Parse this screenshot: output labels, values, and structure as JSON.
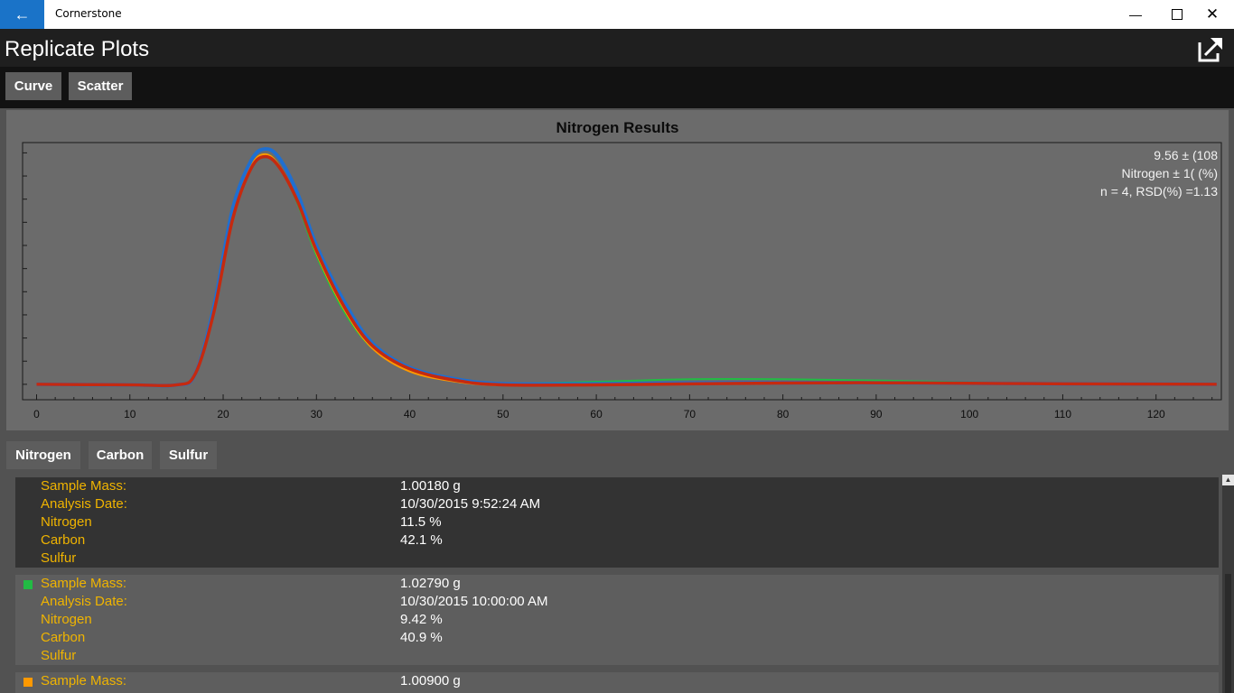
{
  "titlebar": {
    "app_title": "Cornerstone"
  },
  "header": {
    "page_title": "Replicate Plots"
  },
  "plot_tabs": [
    "Curve",
    "Scatter"
  ],
  "element_tabs": [
    "Nitrogen",
    "Carbon",
    "Sulfur"
  ],
  "colors": {
    "accent": "#1a73c8",
    "label": "#f0b400",
    "green": "#22bb44",
    "orange": "#ff9900",
    "blue": "#1f6fd1",
    "red": "#c42a10"
  },
  "chart_data": {
    "type": "line",
    "title": "Nitrogen Results",
    "stats_lines": [
      "9.56  ± (108",
      "Nitrogen ± 1( (%)",
      "n = 4, RSD(%) =1.13"
    ],
    "xlim": [
      -1.5,
      127
    ],
    "ylim": [
      0,
      1
    ],
    "grid": false,
    "x_ticks": [
      0,
      10,
      20,
      30,
      40,
      50,
      60,
      70,
      80,
      90,
      100,
      110,
      120
    ],
    "series": [
      {
        "color": "#22bb44",
        "values": [
          [
            0,
            0.06
          ],
          [
            10,
            0.06
          ],
          [
            15,
            0.06
          ],
          [
            17,
            0.1
          ],
          [
            19,
            0.35
          ],
          [
            21,
            0.72
          ],
          [
            23,
            0.91
          ],
          [
            24.5,
            0.955
          ],
          [
            26,
            0.91
          ],
          [
            28,
            0.76
          ],
          [
            30,
            0.56
          ],
          [
            33,
            0.34
          ],
          [
            36,
            0.2
          ],
          [
            40,
            0.115
          ],
          [
            45,
            0.075
          ],
          [
            50,
            0.062
          ],
          [
            60,
            0.07
          ],
          [
            70,
            0.08
          ],
          [
            80,
            0.08
          ],
          [
            90,
            0.075
          ],
          [
            100,
            0.068
          ],
          [
            110,
            0.064
          ],
          [
            126.5,
            0.062
          ]
        ]
      },
      {
        "color": "#ff9900",
        "values": [
          [
            0,
            0.06
          ],
          [
            10,
            0.058
          ],
          [
            15,
            0.058
          ],
          [
            17,
            0.1
          ],
          [
            19,
            0.35
          ],
          [
            21,
            0.72
          ],
          [
            23,
            0.91
          ],
          [
            24.5,
            0.955
          ],
          [
            26,
            0.91
          ],
          [
            28,
            0.77
          ],
          [
            30,
            0.57
          ],
          [
            33,
            0.35
          ],
          [
            36,
            0.2
          ],
          [
            40,
            0.11
          ],
          [
            45,
            0.07
          ],
          [
            50,
            0.056
          ],
          [
            60,
            0.058
          ],
          [
            70,
            0.062
          ],
          [
            80,
            0.064
          ],
          [
            90,
            0.064
          ],
          [
            100,
            0.062
          ],
          [
            110,
            0.06
          ],
          [
            126.5,
            0.06
          ]
        ]
      },
      {
        "color": "#1f6fd1",
        "values": [
          [
            0,
            0.06
          ],
          [
            10,
            0.058
          ],
          [
            15,
            0.058
          ],
          [
            17,
            0.1
          ],
          [
            19,
            0.36
          ],
          [
            21,
            0.74
          ],
          [
            23,
            0.93
          ],
          [
            24.5,
            0.975
          ],
          [
            26,
            0.94
          ],
          [
            28,
            0.8
          ],
          [
            30,
            0.6
          ],
          [
            33,
            0.38
          ],
          [
            36,
            0.22
          ],
          [
            40,
            0.125
          ],
          [
            45,
            0.08
          ],
          [
            50,
            0.062
          ],
          [
            60,
            0.062
          ],
          [
            70,
            0.065
          ],
          [
            80,
            0.066
          ],
          [
            90,
            0.066
          ],
          [
            100,
            0.064
          ],
          [
            110,
            0.062
          ],
          [
            126.5,
            0.06
          ]
        ]
      },
      {
        "color": "#c42a10",
        "values": [
          [
            0,
            0.06
          ],
          [
            10,
            0.058
          ],
          [
            15,
            0.058
          ],
          [
            17,
            0.1
          ],
          [
            19,
            0.34
          ],
          [
            21,
            0.7
          ],
          [
            23,
            0.9
          ],
          [
            24.5,
            0.945
          ],
          [
            26,
            0.905
          ],
          [
            28,
            0.77
          ],
          [
            30,
            0.58
          ],
          [
            33,
            0.36
          ],
          [
            36,
            0.21
          ],
          [
            40,
            0.12
          ],
          [
            45,
            0.075
          ],
          [
            50,
            0.058
          ],
          [
            60,
            0.058
          ],
          [
            70,
            0.062
          ],
          [
            80,
            0.065
          ],
          [
            90,
            0.066
          ],
          [
            100,
            0.064
          ],
          [
            110,
            0.062
          ],
          [
            126.5,
            0.06
          ]
        ]
      }
    ]
  },
  "results": [
    {
      "swatch": "",
      "rows": [
        {
          "label": "Sample Mass:",
          "value": "1.00180 g"
        },
        {
          "label": "Analysis Date:",
          "value": "10/30/2015 9:52:24 AM"
        },
        {
          "label": "Nitrogen",
          "value": "11.5 %"
        },
        {
          "label": "Carbon",
          "value": "42.1 %"
        },
        {
          "label": "Sulfur",
          "value": ""
        }
      ]
    },
    {
      "swatch": "#22bb44",
      "rows": [
        {
          "label": "Sample Mass:",
          "value": "1.02790 g"
        },
        {
          "label": "Analysis Date:",
          "value": "10/30/2015 10:00:00 AM"
        },
        {
          "label": "Nitrogen",
          "value": "9.42 %"
        },
        {
          "label": "Carbon",
          "value": "40.9 %"
        },
        {
          "label": "Sulfur",
          "value": ""
        }
      ]
    },
    {
      "swatch": "#ff9900",
      "rows": [
        {
          "label": "Sample Mass:",
          "value": "1.00900 g"
        }
      ]
    }
  ]
}
